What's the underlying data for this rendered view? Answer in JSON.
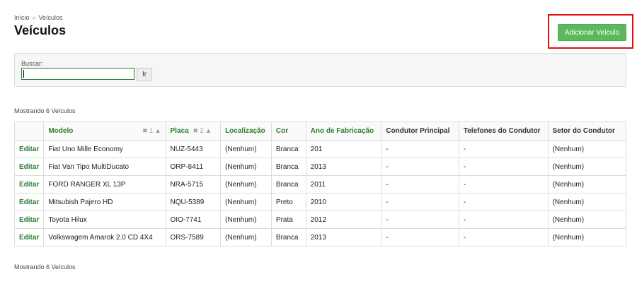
{
  "breadcrumb": {
    "home": "Início",
    "separator": "»",
    "current": "Veículos"
  },
  "title": "Veículos",
  "add_button": "Adicionar Veículo",
  "search": {
    "label": "Buscar:",
    "value": "",
    "go_label": "Ir"
  },
  "showing_text": "Mostrando 6 Veículos",
  "table": {
    "headers": {
      "modelo": "Modelo",
      "placa": "Placa",
      "localizacao": "Localização",
      "cor": "Cor",
      "ano": "Ano de Fabricação",
      "condutor": "Condutor Principal",
      "telefones": "Telefones do Condutor",
      "setor": "Setor do Condutor"
    },
    "sort": {
      "modelo_priority": "1",
      "placa_priority": "2",
      "remove_glyph": "✖",
      "asc_glyph": "▲"
    },
    "edit_label": "Editar",
    "rows": [
      {
        "modelo": "Fiat Uno Mille Economy",
        "placa": "NUZ-5443",
        "localizacao": "(Nenhum)",
        "cor": "Branca",
        "ano": "201",
        "condutor": "-",
        "telefones": "-",
        "setor": "(Nenhum)"
      },
      {
        "modelo": "Fiat Van Tipo MultiDucato",
        "placa": "ORP-8411",
        "localizacao": "(Nenhum)",
        "cor": "Branca",
        "ano": "2013",
        "condutor": "-",
        "telefones": "-",
        "setor": "(Nenhum)"
      },
      {
        "modelo": "FORD RANGER XL 13P",
        "placa": "NRA-5715",
        "localizacao": "(Nenhum)",
        "cor": "Branca",
        "ano": "2011",
        "condutor": "-",
        "telefones": "-",
        "setor": "(Nenhum)"
      },
      {
        "modelo": "Mitsubish Pajero HD",
        "placa": "NQU-5389",
        "localizacao": "(Nenhum)",
        "cor": "Preto",
        "ano": "2010",
        "condutor": "-",
        "telefones": "-",
        "setor": "(Nenhum)"
      },
      {
        "modelo": "Toyota Hilux",
        "placa": "OIO-7741",
        "localizacao": "(Nenhum)",
        "cor": "Prata",
        "ano": "2012",
        "condutor": "-",
        "telefones": "-",
        "setor": "(Nenhum)"
      },
      {
        "modelo": "Volkswagem Amarok 2.0 CD 4X4",
        "placa": "ORS-7589",
        "localizacao": "(Nenhum)",
        "cor": "Branca",
        "ano": "2013",
        "condutor": "-",
        "telefones": "-",
        "setor": "(Nenhum)"
      }
    ]
  }
}
